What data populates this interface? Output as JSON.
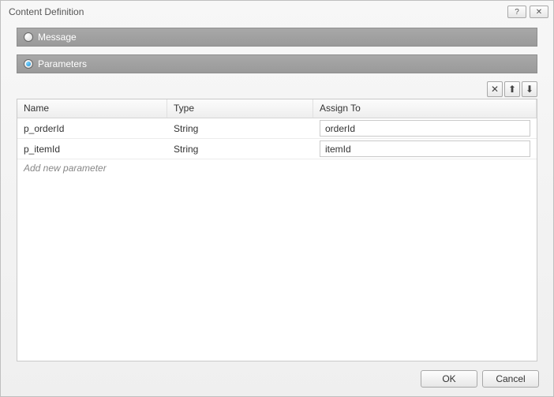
{
  "window": {
    "title": "Content Definition",
    "help_symbol": "?",
    "close_symbol": "✕"
  },
  "options": {
    "message": {
      "label": "Message",
      "selected": false
    },
    "parameters": {
      "label": "Parameters",
      "selected": true
    }
  },
  "toolbar": {
    "delete_symbol": "✕",
    "up_symbol": "⬆",
    "down_symbol": "⬇"
  },
  "table": {
    "headers": {
      "name": "Name",
      "type": "Type",
      "assign": "Assign To"
    },
    "rows": [
      {
        "name": "p_orderId",
        "type": "String",
        "assign": "orderId"
      },
      {
        "name": "p_itemId",
        "type": "String",
        "assign": "itemId"
      }
    ],
    "add_placeholder": "Add new parameter"
  },
  "buttons": {
    "ok": "OK",
    "cancel": "Cancel"
  }
}
